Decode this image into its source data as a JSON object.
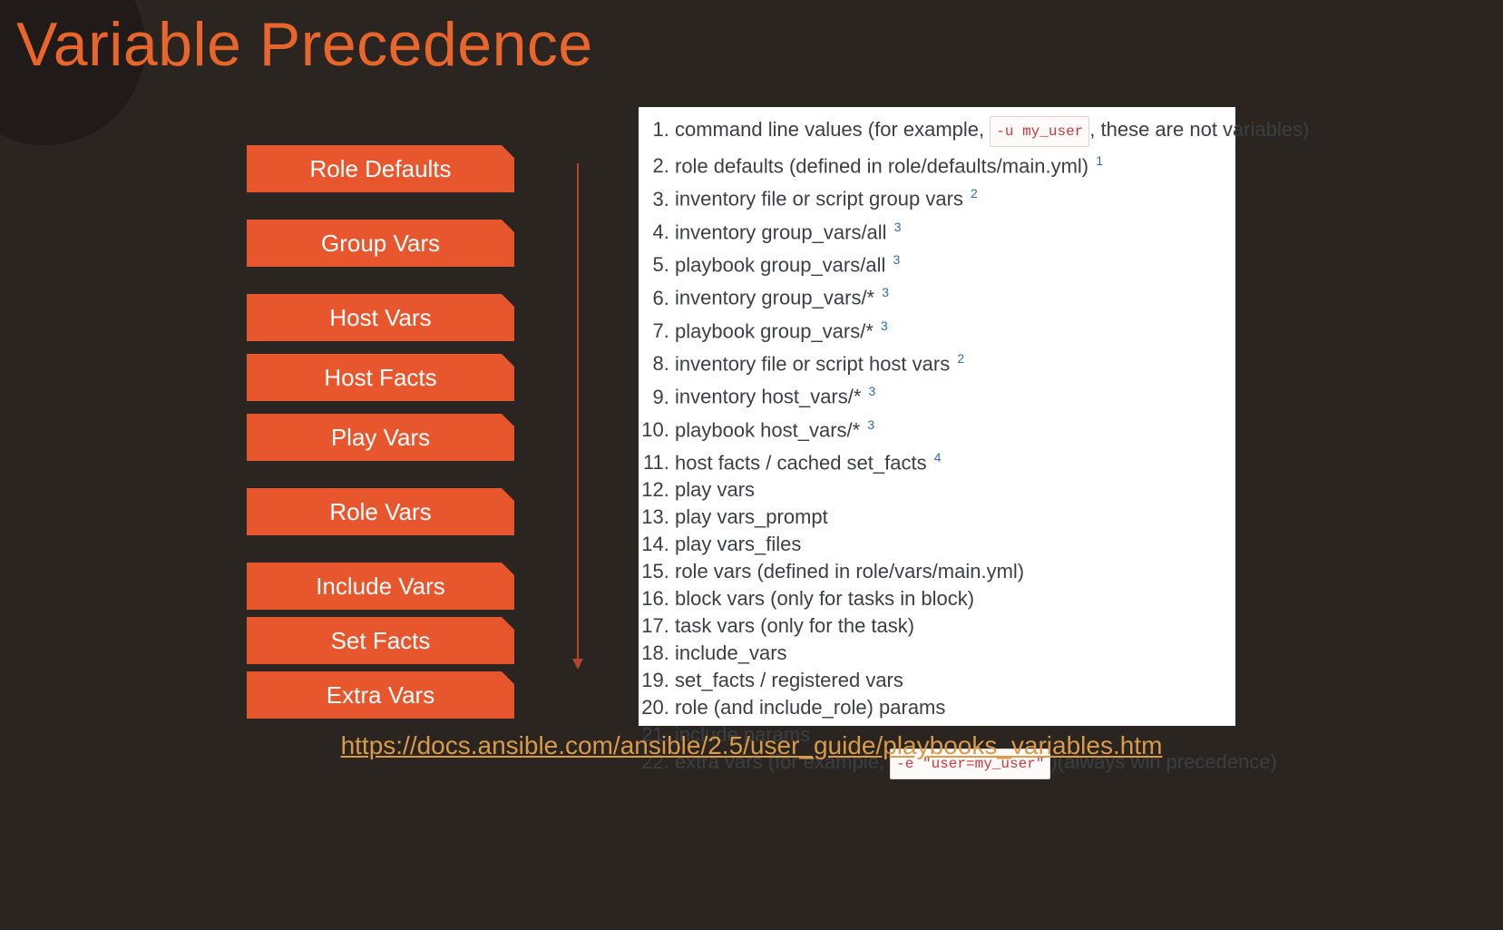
{
  "title": "Variable Precedence",
  "blocks": [
    "Role Defaults",
    "Group Vars",
    "Host Vars",
    "Host Facts",
    "Play Vars",
    "Role Vars",
    "Include Vars",
    "Set Facts",
    "Extra Vars"
  ],
  "list": [
    {
      "pre": "command line values (for example, ",
      "code": "-u my_user",
      "post": ", these are not variables)",
      "sup": ""
    },
    {
      "pre": "role defaults (defined in role/defaults/main.yml) ",
      "code": "",
      "post": "",
      "sup": "1"
    },
    {
      "pre": "inventory file or script group vars ",
      "code": "",
      "post": "",
      "sup": "2"
    },
    {
      "pre": "inventory group_vars/all ",
      "code": "",
      "post": "",
      "sup": "3"
    },
    {
      "pre": "playbook group_vars/all ",
      "code": "",
      "post": "",
      "sup": "3"
    },
    {
      "pre": "inventory group_vars/* ",
      "code": "",
      "post": "",
      "sup": "3"
    },
    {
      "pre": "playbook group_vars/* ",
      "code": "",
      "post": "",
      "sup": "3"
    },
    {
      "pre": "inventory file or script host vars ",
      "code": "",
      "post": "",
      "sup": "2"
    },
    {
      "pre": "inventory host_vars/* ",
      "code": "",
      "post": "",
      "sup": "3"
    },
    {
      "pre": "playbook host_vars/* ",
      "code": "",
      "post": "",
      "sup": "3"
    },
    {
      "pre": "host facts / cached set_facts ",
      "code": "",
      "post": "",
      "sup": "4"
    },
    {
      "pre": "play vars",
      "code": "",
      "post": "",
      "sup": ""
    },
    {
      "pre": "play vars_prompt",
      "code": "",
      "post": "",
      "sup": ""
    },
    {
      "pre": "play vars_files",
      "code": "",
      "post": "",
      "sup": ""
    },
    {
      "pre": "role vars (defined in role/vars/main.yml)",
      "code": "",
      "post": "",
      "sup": ""
    },
    {
      "pre": "block vars (only for tasks in block)",
      "code": "",
      "post": "",
      "sup": ""
    },
    {
      "pre": "task vars (only for the task)",
      "code": "",
      "post": "",
      "sup": ""
    },
    {
      "pre": "include_vars",
      "code": "",
      "post": "",
      "sup": ""
    },
    {
      "pre": "set_facts / registered vars",
      "code": "",
      "post": "",
      "sup": ""
    },
    {
      "pre": "role (and include_role) params",
      "code": "",
      "post": "",
      "sup": ""
    },
    {
      "pre": "include params",
      "code": "",
      "post": "",
      "sup": ""
    },
    {
      "pre": "extra vars (for example, ",
      "code": "-e \"user=my_user\"",
      "post": ")(always win precedence)",
      "sup": ""
    }
  ],
  "link": {
    "text": "https://docs.ansible.com/ansible/2.5/user_guide/playbooks_variables.htm",
    "href": "https://docs.ansible.com/ansible/2.5/user_guide/playbooks_variables.htm"
  }
}
